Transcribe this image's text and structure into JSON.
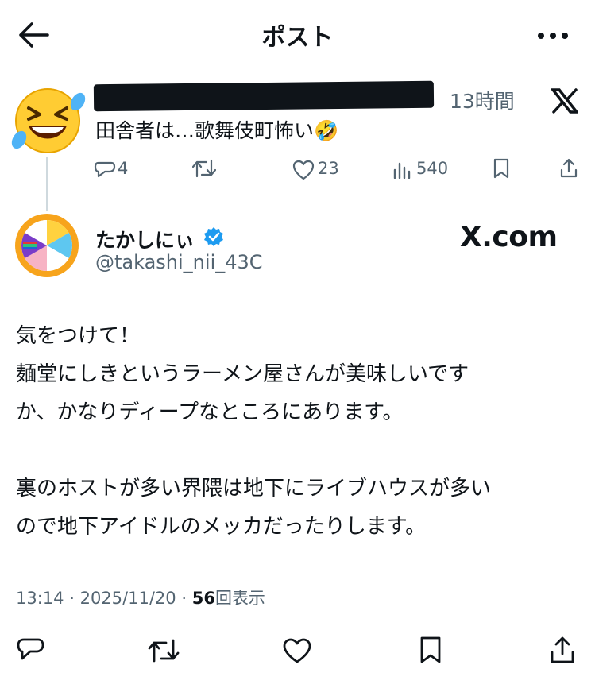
{
  "header": {
    "title": "ポスト"
  },
  "parent": {
    "time": "13時間",
    "text": "田舎者は…歌舞伎町怖い🤣",
    "stats": {
      "replies": "4",
      "likes": "23",
      "views": "540"
    }
  },
  "main": {
    "display_name": "たかしにぃ",
    "handle": "@takashi_nii_43C",
    "watermark": "X.com",
    "body_lines": [
      "気をつけて！",
      "麺堂にしきというラーメン屋さんが美味しいです",
      "か、かなりディープなところにあります。",
      "",
      "裏のホストが多い界隈は地下にライブハウスが多い",
      "ので地下アイドルのメッカだったりします。"
    ],
    "meta": {
      "time": "13:14",
      "sep": "·",
      "date": "2025/11/20",
      "views": "56",
      "views_label": "回表示"
    }
  },
  "icons": [
    "back-arrow-icon",
    "more-icon",
    "x-logo-icon",
    "reply-icon",
    "repost-icon",
    "like-icon",
    "views-icon",
    "bookmark-icon",
    "share-icon",
    "verified-icon"
  ],
  "colors": {
    "text": "#0f1419",
    "secondary": "#536471",
    "verified": "#1d9bf0",
    "thread_line": "#cfd9de"
  }
}
